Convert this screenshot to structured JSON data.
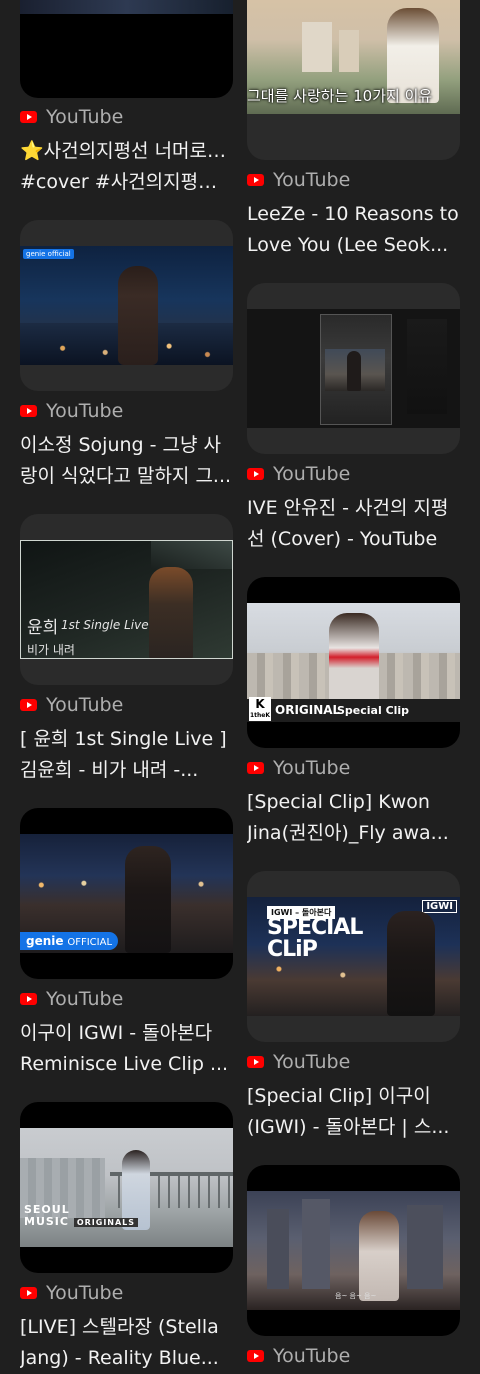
{
  "feed": {
    "source_label": "YouTube",
    "left": [
      {
        "title_l1": "⭐사건의지평선 너머로~~",
        "title_l2": "#cover #사건의지평선 ..."
      },
      {
        "title_l1": "이소정 Sojung - 그냥 사",
        "title_l2": "랑이 식었다고 말하지 그..."
      },
      {
        "title_l1": "[ 윤희 1st Single Live ]",
        "title_l2": "김윤희 - 비가 내려 -..."
      },
      {
        "title_l1": "이구이 IGWI - 돌아본다",
        "title_l2": "Reminisce Live Clip ..."
      },
      {
        "title_l1": "[LIVE] 스텔라장 (Stella",
        "title_l2": "Jang) - Reality Blue..."
      }
    ],
    "right": [
      {
        "title_l1": "LeeZe - 10 Reasons to",
        "title_l2": "Love You (Lee Seok..."
      },
      {
        "title_l1": "IVE 안유진 - 사건의 지평",
        "title_l2": "선 (Cover) - YouTube"
      },
      {
        "title_l1": "[Special Clip] Kwon",
        "title_l2": "Jina(권진아)_Fly awa..."
      },
      {
        "title_l1": "[Special Clip] 이구이",
        "title_l2": "(IGWI) - 돌아본다 | 스..."
      }
    ]
  },
  "thumb_text": {
    "leeze_caption": "그대를 사랑하는 10가지 이유",
    "genie_small": "genie official",
    "yunhee_name": "윤희",
    "yunhee_single": "1st Single Live",
    "yunhee_song": "비가 내려",
    "genie_label": "genie",
    "official_label": "OFFICIAL",
    "k_logo": "K",
    "thek_label": "1theK",
    "original_label": "ORIGINAL",
    "special_clip_label": "Special Clip",
    "igwi_badge": "IGWI",
    "igwi_song": "IGWI – 돌아본다",
    "special_big": "SPECIAL",
    "clip_big": "CLiP",
    "seoul_label": "SEOUL",
    "music_label": "MUSIC",
    "originals_label": "ORIGINALS",
    "lyric_line": "음~ 음~ 음~"
  },
  "colors": {
    "background": "#1f1f1f",
    "card": "#2b2b2b",
    "youtube_red": "#ff0000"
  }
}
